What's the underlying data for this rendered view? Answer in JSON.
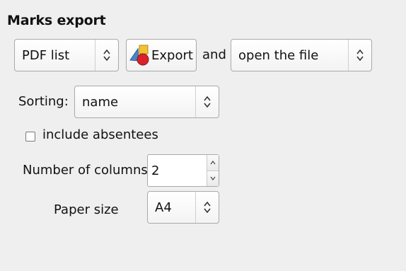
{
  "section": {
    "title": "Marks export"
  },
  "format_select": {
    "value": "PDF list"
  },
  "export_button": {
    "label": "Export"
  },
  "and_label": "and",
  "after_select": {
    "value": "open the file"
  },
  "sorting": {
    "label": "Sorting:",
    "value": "name"
  },
  "absentees": {
    "label": "include absentees",
    "checked": false
  },
  "columns": {
    "label": "Number of columns",
    "value": "2"
  },
  "paper": {
    "label": "Paper size",
    "value": "A4"
  },
  "icons": {
    "updown": "updown-arrows-icon",
    "export": "export-shapes-icon",
    "spin_up": "spin-up-icon",
    "spin_down": "spin-down-icon"
  }
}
